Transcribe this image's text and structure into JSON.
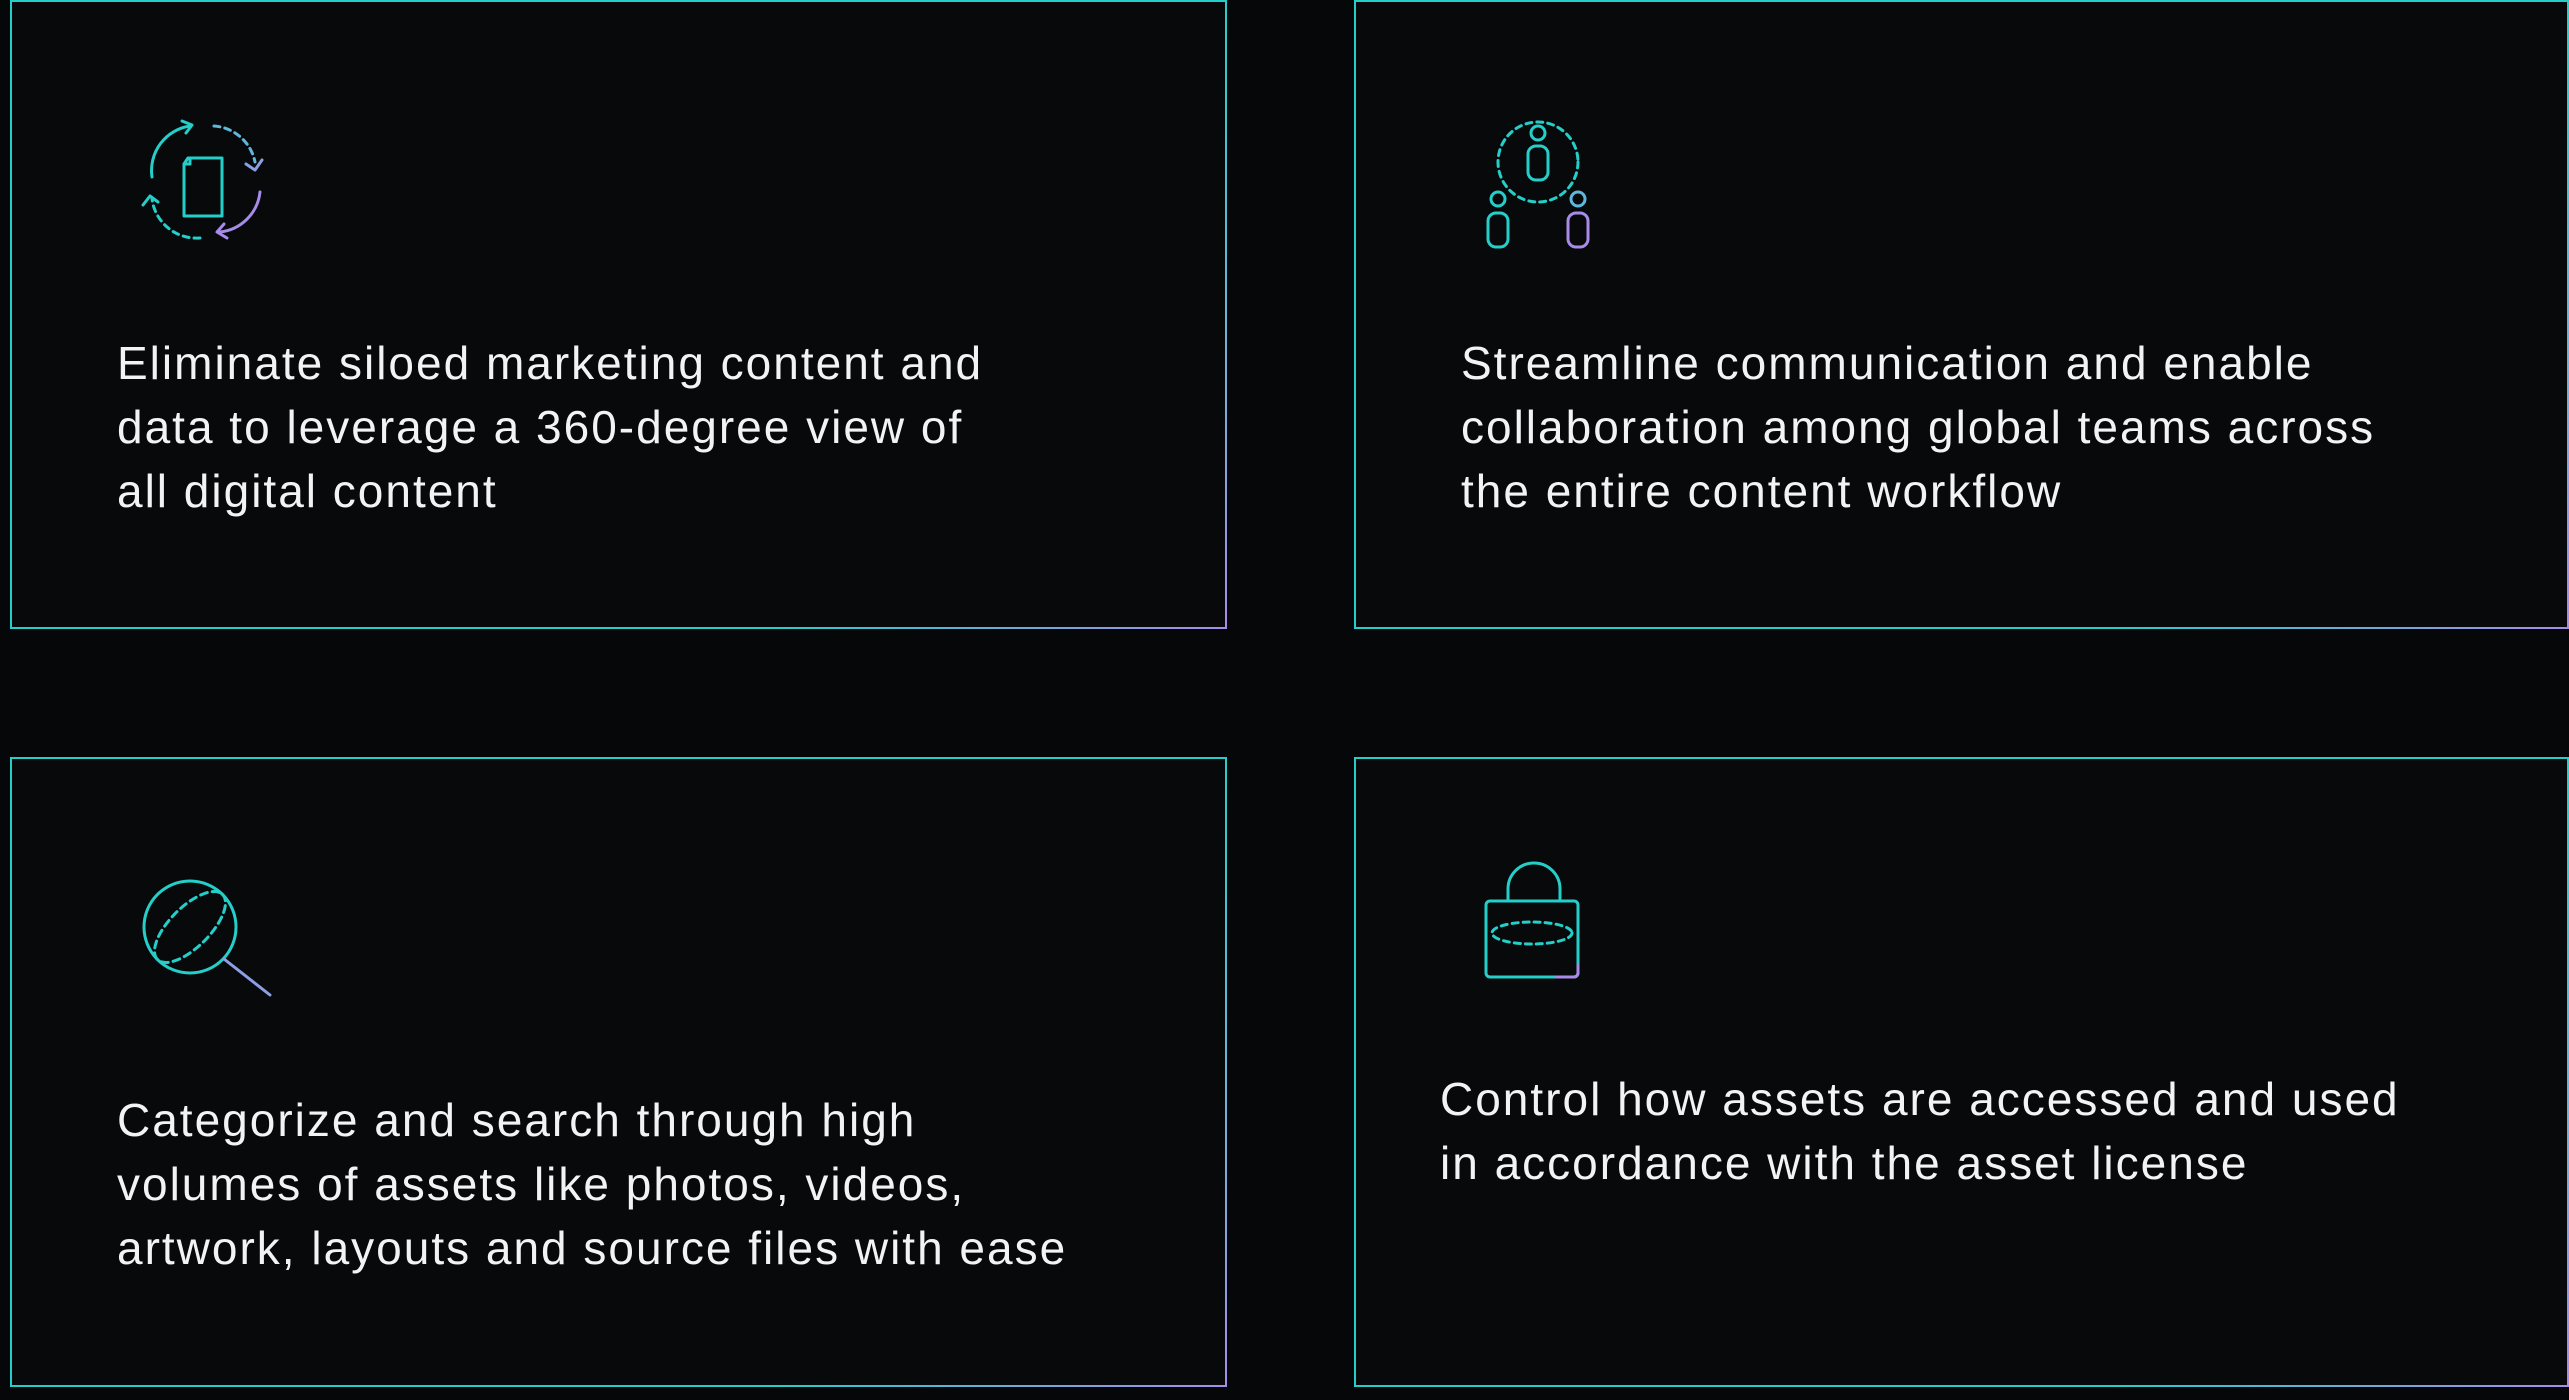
{
  "colors": {
    "background": "#060708",
    "card_background": "#08090a",
    "accent_teal": "#25cfc9",
    "accent_purple": "#a78be8",
    "text": "#f2f3f4"
  },
  "cards": [
    {
      "icon": "content-sync-icon",
      "text": "Eliminate siloed marketing content and\ndata to leverage a 360-degree view of\nall digital content"
    },
    {
      "icon": "team-collaboration-icon",
      "text": "Streamline communication and enable\ncollaboration among global teams across\nthe entire content workflow"
    },
    {
      "icon": "search-globe-icon",
      "text": "Categorize and search through high\nvolumes of assets like photos, videos,\nartwork, layouts and source files with ease"
    },
    {
      "icon": "lock-icon",
      "text": "Control how assets are accessed and used\nin accordance with the asset license"
    }
  ]
}
